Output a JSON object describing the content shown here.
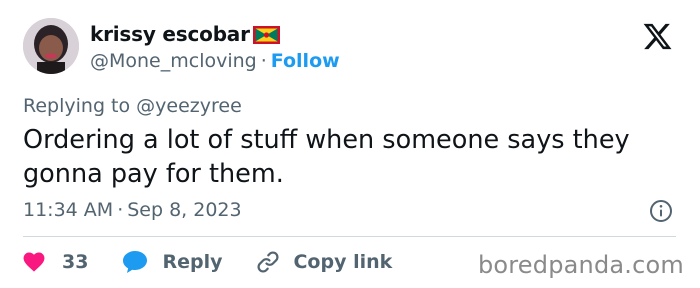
{
  "author": {
    "display_name": "krissy escobar",
    "flag_icon": "grenada-flag-icon",
    "handle": "@Mone_mcloving",
    "separator": "·",
    "follow_label": "Follow"
  },
  "platform_icon": "x-logo-icon",
  "reply": {
    "prefix": "Replying to",
    "mention": "@yeezyree"
  },
  "tweet": {
    "text": "Ordering a lot of stuff when someone says they gonna pay for them."
  },
  "meta": {
    "time": "11:34 AM",
    "separator": "·",
    "date": "Sep 8, 2023"
  },
  "actions": {
    "like_count": "33",
    "reply_label": "Reply",
    "copy_link_label": "Copy link"
  },
  "watermark": "boredpanda.com",
  "colors": {
    "accent": "#1d9bf0",
    "like": "#f91880",
    "text": "#0f1419",
    "muted": "#536471"
  }
}
